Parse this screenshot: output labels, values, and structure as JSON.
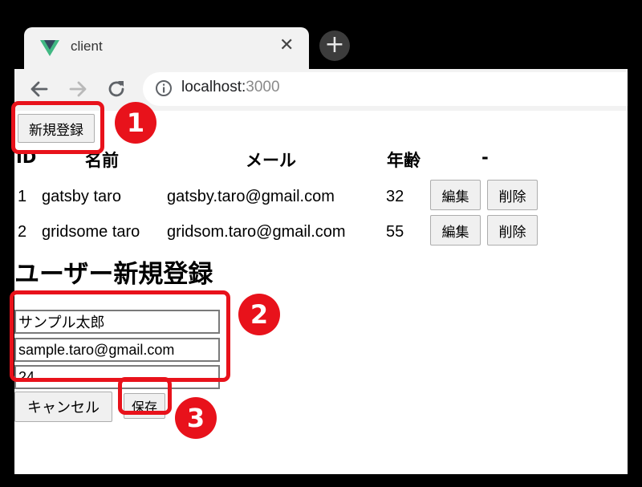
{
  "browser": {
    "tab_title": "client",
    "close_glyph": "✕",
    "new_tab_glyph": "+",
    "url_host": "localhost:",
    "url_port": "3000",
    "icons": [
      "vue-logo-icon",
      "close-icon",
      "plus-icon",
      "back-arrow-icon",
      "forward-arrow-icon",
      "reload-icon",
      "info-icon"
    ]
  },
  "page": {
    "new_button_label": "新規登録",
    "table": {
      "headers": [
        "ID",
        "名前",
        "メール",
        "年齢",
        "-"
      ],
      "rows": [
        {
          "id": "1",
          "name": "gatsby taro",
          "email": "gatsby.taro@gmail.com",
          "age": "32",
          "edit_label": "編集",
          "delete_label": "削除"
        },
        {
          "id": "2",
          "name": "gridsome taro",
          "email": "gridsom.taro@gmail.com",
          "age": "55",
          "edit_label": "編集",
          "delete_label": "削除"
        }
      ]
    },
    "form": {
      "heading": "ユーザー新規登録",
      "name_value": "サンプル太郎",
      "email_value": "sample.taro@gmail.com",
      "age_value": "24",
      "cancel_label": "キャンセル",
      "save_label": "保存"
    }
  },
  "annotations": {
    "badge_1": "1",
    "badge_2": "2",
    "badge_3": "3",
    "color": "#e8121b"
  }
}
